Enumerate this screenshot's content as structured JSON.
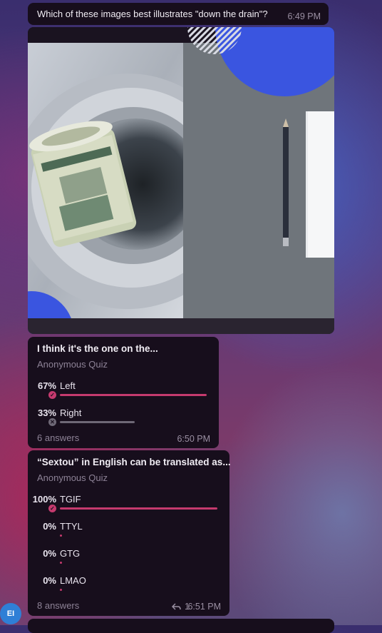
{
  "question": {
    "text": "Which of these images best illustrates \"down the drain\"?",
    "time": "6:49 PM"
  },
  "photo": {
    "alt_icon": "image-drain-vs-pencil"
  },
  "poll1": {
    "title": "I think it's the one on the...",
    "type": "Anonymous Quiz",
    "options": [
      {
        "pct": "67%",
        "label": "Left",
        "fraction": 0.67,
        "correct": true
      },
      {
        "pct": "33%",
        "label": "Right",
        "fraction": 0.33,
        "correct": false
      }
    ],
    "answers": "6 answers",
    "time": "6:50 PM"
  },
  "poll2": {
    "title": "“Sextou” in English can be translated as...",
    "type": "Anonymous Quiz",
    "options": [
      {
        "pct": "100%",
        "label": "TGIF",
        "fraction": 1.0,
        "correct": true
      },
      {
        "pct": "0%",
        "label": "TTYL",
        "fraction": 0.0
      },
      {
        "pct": "0%",
        "label": "GTG",
        "fraction": 0.0
      },
      {
        "pct": "0%",
        "label": "LMAO",
        "fraction": 0.0
      }
    ],
    "answers": "8 answers",
    "replies": "1",
    "time": "6:51 PM"
  },
  "avatar": {
    "initials": "EI",
    "color": "#2f7fd6"
  },
  "colors": {
    "accent": "#c53a6e",
    "bubble": "#170e1c",
    "muted": "#8d8296"
  }
}
